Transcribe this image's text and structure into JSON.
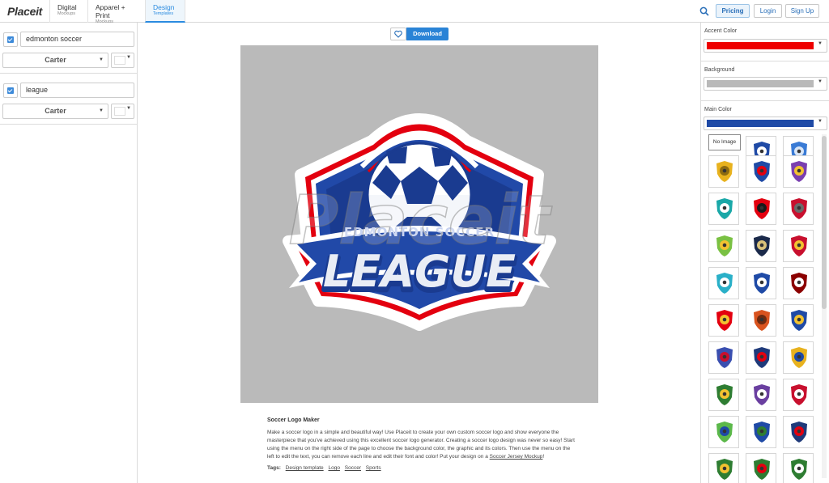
{
  "brand": "Placeit",
  "nav": [
    {
      "title": "Digital",
      "sub": "Mockups"
    },
    {
      "title": "Apparel + Print",
      "sub": "Mockups"
    },
    {
      "title": "Design",
      "sub": "Templates"
    }
  ],
  "topbar": {
    "pricing": "Pricing",
    "login": "Login",
    "signup": "Sign Up",
    "search_icon": "search-icon"
  },
  "left": {
    "lines": [
      {
        "text": "edmonton soccer",
        "font": "Carter"
      },
      {
        "text": "league",
        "font": "Carter"
      }
    ]
  },
  "center": {
    "download": "Download",
    "favorite_icon": "heart-icon"
  },
  "logo": {
    "top_text": "EDMONTON SOCCER",
    "main_text": "LEAGUE",
    "watermark": "Placeit"
  },
  "description": {
    "title": "Soccer Logo Maker",
    "body": "Make a soccer logo in a simple and beautiful way! Use Placeit to create your own custom soccer logo and show everyone the masterpiece that you've achieved using this excellent soccer logo generator. Creating a soccer logo design was never so easy! Start using the menu on the right side of the page to choose the background color, the graphic and its colors. Then use the menu on the left to edit the text, you can remove each line and edit their font and color! Put your design on a",
    "link": "Soccer Jersey Mockup",
    "end": "!",
    "tags_label": "Tags:",
    "tags": [
      "Design template",
      "Logo",
      "Soccer",
      "Sports"
    ]
  },
  "right": {
    "accent_label": "Accent Color",
    "accent_color": "#ee0000",
    "background_label": "Background",
    "background_color": "#b9b9b9",
    "main_label": "Main Color",
    "main_color": "#1f4aa6",
    "no_image": "No Image"
  },
  "colors": {
    "brand_blue": "#2a83d6"
  }
}
